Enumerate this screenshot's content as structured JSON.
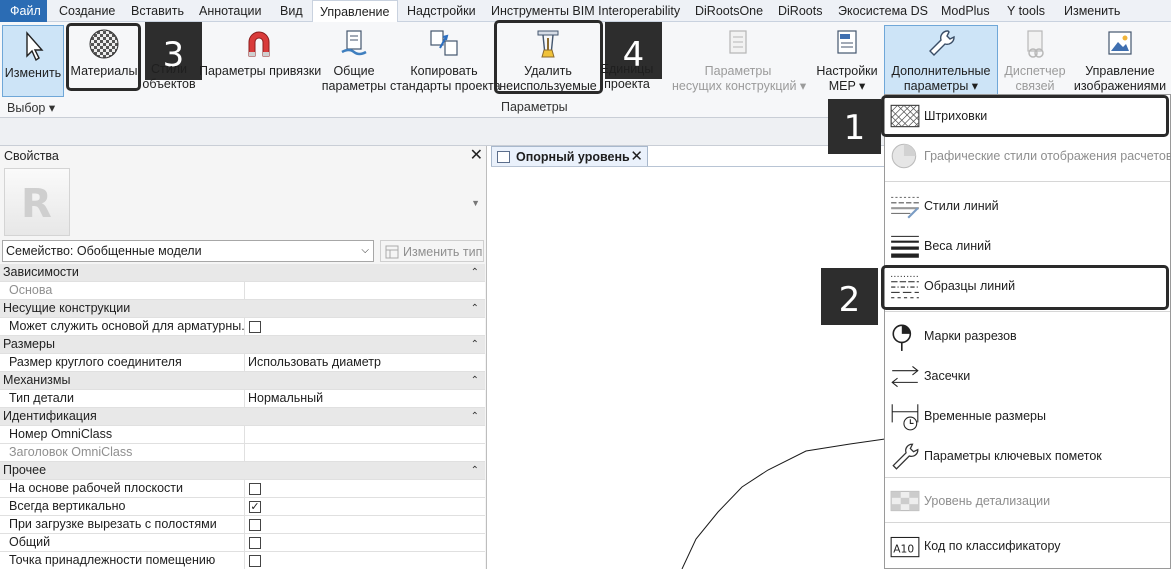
{
  "tabs": [
    "Файл",
    "Создание",
    "Вставить",
    "Аннотации",
    "Вид",
    "Управление",
    "Надстройки",
    "Инструменты BIM Interoperability",
    "DiRootsOne",
    "DiRoots",
    "Экосистема DS",
    "ModPlus",
    "Y tools",
    "Изменить"
  ],
  "active_tab": "Управление",
  "ribbon": {
    "modify": "Изменить",
    "select_panel": "Выбор",
    "materials": "Материалы",
    "object_styles": [
      "Стили",
      "объектов"
    ],
    "snap_params": "Параметры привязки",
    "shared_params": [
      "Общие",
      "параметры"
    ],
    "transfer_standards": [
      "Копировать",
      "стандарты проекта"
    ],
    "purge_unused": [
      "Удалить",
      "неиспользуемые"
    ],
    "project_units": [
      "Единицы",
      "проекта"
    ],
    "settings_panel": "Параметры",
    "structural_settings": [
      "Параметры",
      "несущих конструкций"
    ],
    "mep_settings": [
      "Настройки",
      "MEP"
    ],
    "additional_settings": [
      "Дополнительные",
      "параметры"
    ],
    "link_manager": [
      "Диспетчер",
      "связей"
    ],
    "manage_images": [
      "Управление",
      "изображениями"
    ]
  },
  "callouts": {
    "n1": "1",
    "n2": "2",
    "n3": "3",
    "n4": "4"
  },
  "properties": {
    "title": "Свойства",
    "family_select": "Семейство: Обобщенные модели",
    "edit_type": "Изменить тип",
    "rows": [
      {
        "type": "cat",
        "label": "Зависимости"
      },
      {
        "type": "prop",
        "label": "Основа",
        "value": "",
        "greyed": true
      },
      {
        "type": "cat",
        "label": "Несущие конструкции"
      },
      {
        "type": "prop",
        "label": "Может служить основой для арматурны...",
        "checkbox": false
      },
      {
        "type": "cat",
        "label": "Размеры"
      },
      {
        "type": "prop",
        "label": "Размер круглого соединителя",
        "value": "Использовать диаметр"
      },
      {
        "type": "cat",
        "label": "Механизмы"
      },
      {
        "type": "prop",
        "label": "Тип детали",
        "value": "Нормальный"
      },
      {
        "type": "cat",
        "label": "Идентификация"
      },
      {
        "type": "prop",
        "label": "Номер OmniClass",
        "value": ""
      },
      {
        "type": "prop",
        "label": "Заголовок OmniClass",
        "value": "",
        "greyed": true
      },
      {
        "type": "cat",
        "label": "Прочее"
      },
      {
        "type": "prop",
        "label": "На основе рабочей плоскости",
        "checkbox": false
      },
      {
        "type": "prop",
        "label": "Всегда вертикально",
        "checkbox": true
      },
      {
        "type": "prop",
        "label": "При загрузке вырезать с полостями",
        "checkbox": false
      },
      {
        "type": "prop",
        "label": "Общий",
        "checkbox": false
      },
      {
        "type": "prop",
        "label": "Точка принадлежности помещению",
        "checkbox": false
      }
    ]
  },
  "view_tab": "Опорный уровень",
  "dropdown": {
    "items": [
      {
        "label": "Штриховки",
        "icon": "fill-patterns-icon",
        "disabled": false
      },
      {
        "label": "Графические стили отображения расчетов",
        "icon": "analysis-display-styles-icon",
        "disabled": true
      },
      {
        "label": "Стили линий",
        "icon": "line-styles-icon",
        "disabled": false
      },
      {
        "label": "Веса линий",
        "icon": "line-weights-icon",
        "disabled": false
      },
      {
        "label": "Образцы линий",
        "icon": "line-patterns-icon",
        "disabled": false
      },
      {
        "label": "Марки разрезов",
        "icon": "section-tags-icon",
        "disabled": false
      },
      {
        "label": "Засечки",
        "icon": "arrowheads-icon",
        "disabled": false
      },
      {
        "label": "Временные размеры",
        "icon": "temporary-dimensions-icon",
        "disabled": false
      },
      {
        "label": "Параметры ключевых пометок",
        "icon": "keynoting-settings-icon",
        "disabled": false
      },
      {
        "label": "Уровень детализации",
        "icon": "detail-level-icon",
        "disabled": true
      },
      {
        "label": "Код по классификатору",
        "icon": "assembly-code-icon",
        "disabled": false
      }
    ]
  },
  "colors": {
    "file_tab": "#2b6cb4",
    "highlight": "#cde4f7",
    "callout": "#2d2d2d"
  }
}
